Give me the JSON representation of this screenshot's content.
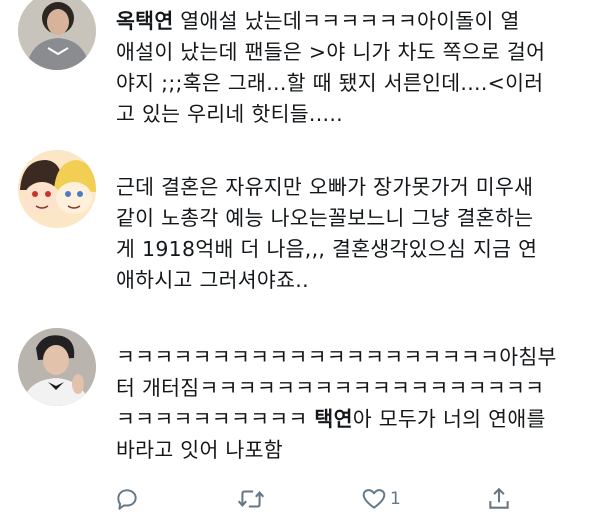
{
  "posts": [
    {
      "lines": [
        {
          "bold": "옥택연",
          "text": " 열애설 났는데ㅋㅋㅋㅋㅋㅋ아이돌이 열"
        },
        {
          "text": "애설이 났는데 팬들은 >야 니가 차도 쪽으로 걸어"
        },
        {
          "text": "야지 ;;;혹은 그래...할 때 됐지 서른인데....<이러"
        },
        {
          "text": "고 있는 우리네 핫티들....."
        }
      ]
    },
    {
      "lines": [
        {
          "text": "근데  결혼은 자유지만 오빠가 장가못가거 미우새"
        },
        {
          "text": "같이 노총각 예능 나오는꼴보느니 그냥 결혼하는"
        },
        {
          "text": "게 1918억배 더 나음,,, 결혼생각있으심 지금 연"
        },
        {
          "text": "애하시고 그러셔야죠.."
        }
      ]
    },
    {
      "lines": [
        {
          "text": "ㅋㅋㅋㅋㅋㅋㅋㅋㅋㅋㅋㅋㅋㅋㅋㅋㅋㅋㅋㅋ아침부"
        },
        {
          "text": "터 개터짐ㅋㅋㅋㅋㅋㅋㅋㅋㅋㅋㅋㅋㅋㅋㅋㅋㅋㅋ"
        },
        {
          "text": "ㅋㅋㅋㅋㅋㅋㅋㅋㅋㅋ ",
          "bold": "택연",
          "after": "아 모두가 너의 연애를"
        },
        {
          "text": "바라고 잇어 나포함"
        }
      ]
    }
  ],
  "actions": {
    "reply_icon": "reply-icon",
    "retweet_icon": "retweet-icon",
    "like_icon": "like-icon",
    "like_count": "1",
    "share_icon": "share-icon",
    "icon_color": "#657786"
  }
}
